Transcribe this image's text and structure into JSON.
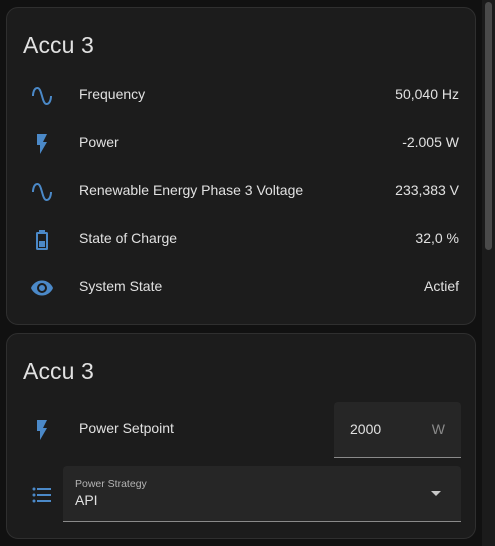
{
  "card1": {
    "title": "Accu 3",
    "rows": [
      {
        "icon": "sine-wave-icon",
        "label": "Frequency",
        "value": "50,040 Hz"
      },
      {
        "icon": "flash-icon",
        "label": "Power",
        "value": "-2.005 W"
      },
      {
        "icon": "sine-wave-icon",
        "label": "Renewable Energy Phase 3 Voltage",
        "value": "233,383 V"
      },
      {
        "icon": "battery-icon",
        "label": "State of Charge",
        "value": "32,0 %"
      },
      {
        "icon": "eye-icon",
        "label": "System State",
        "value": "Actief"
      }
    ]
  },
  "card2": {
    "title": "Accu 3",
    "setpoint": {
      "icon": "flash-icon",
      "label": "Power Setpoint",
      "value": "2000",
      "unit": "W"
    },
    "strategy": {
      "icon": "list-icon",
      "label": "Power Strategy",
      "value": "API"
    }
  },
  "colors": {
    "icon": "#4b89c8",
    "card_bg": "#1c1c1c",
    "page_bg": "#111111"
  }
}
